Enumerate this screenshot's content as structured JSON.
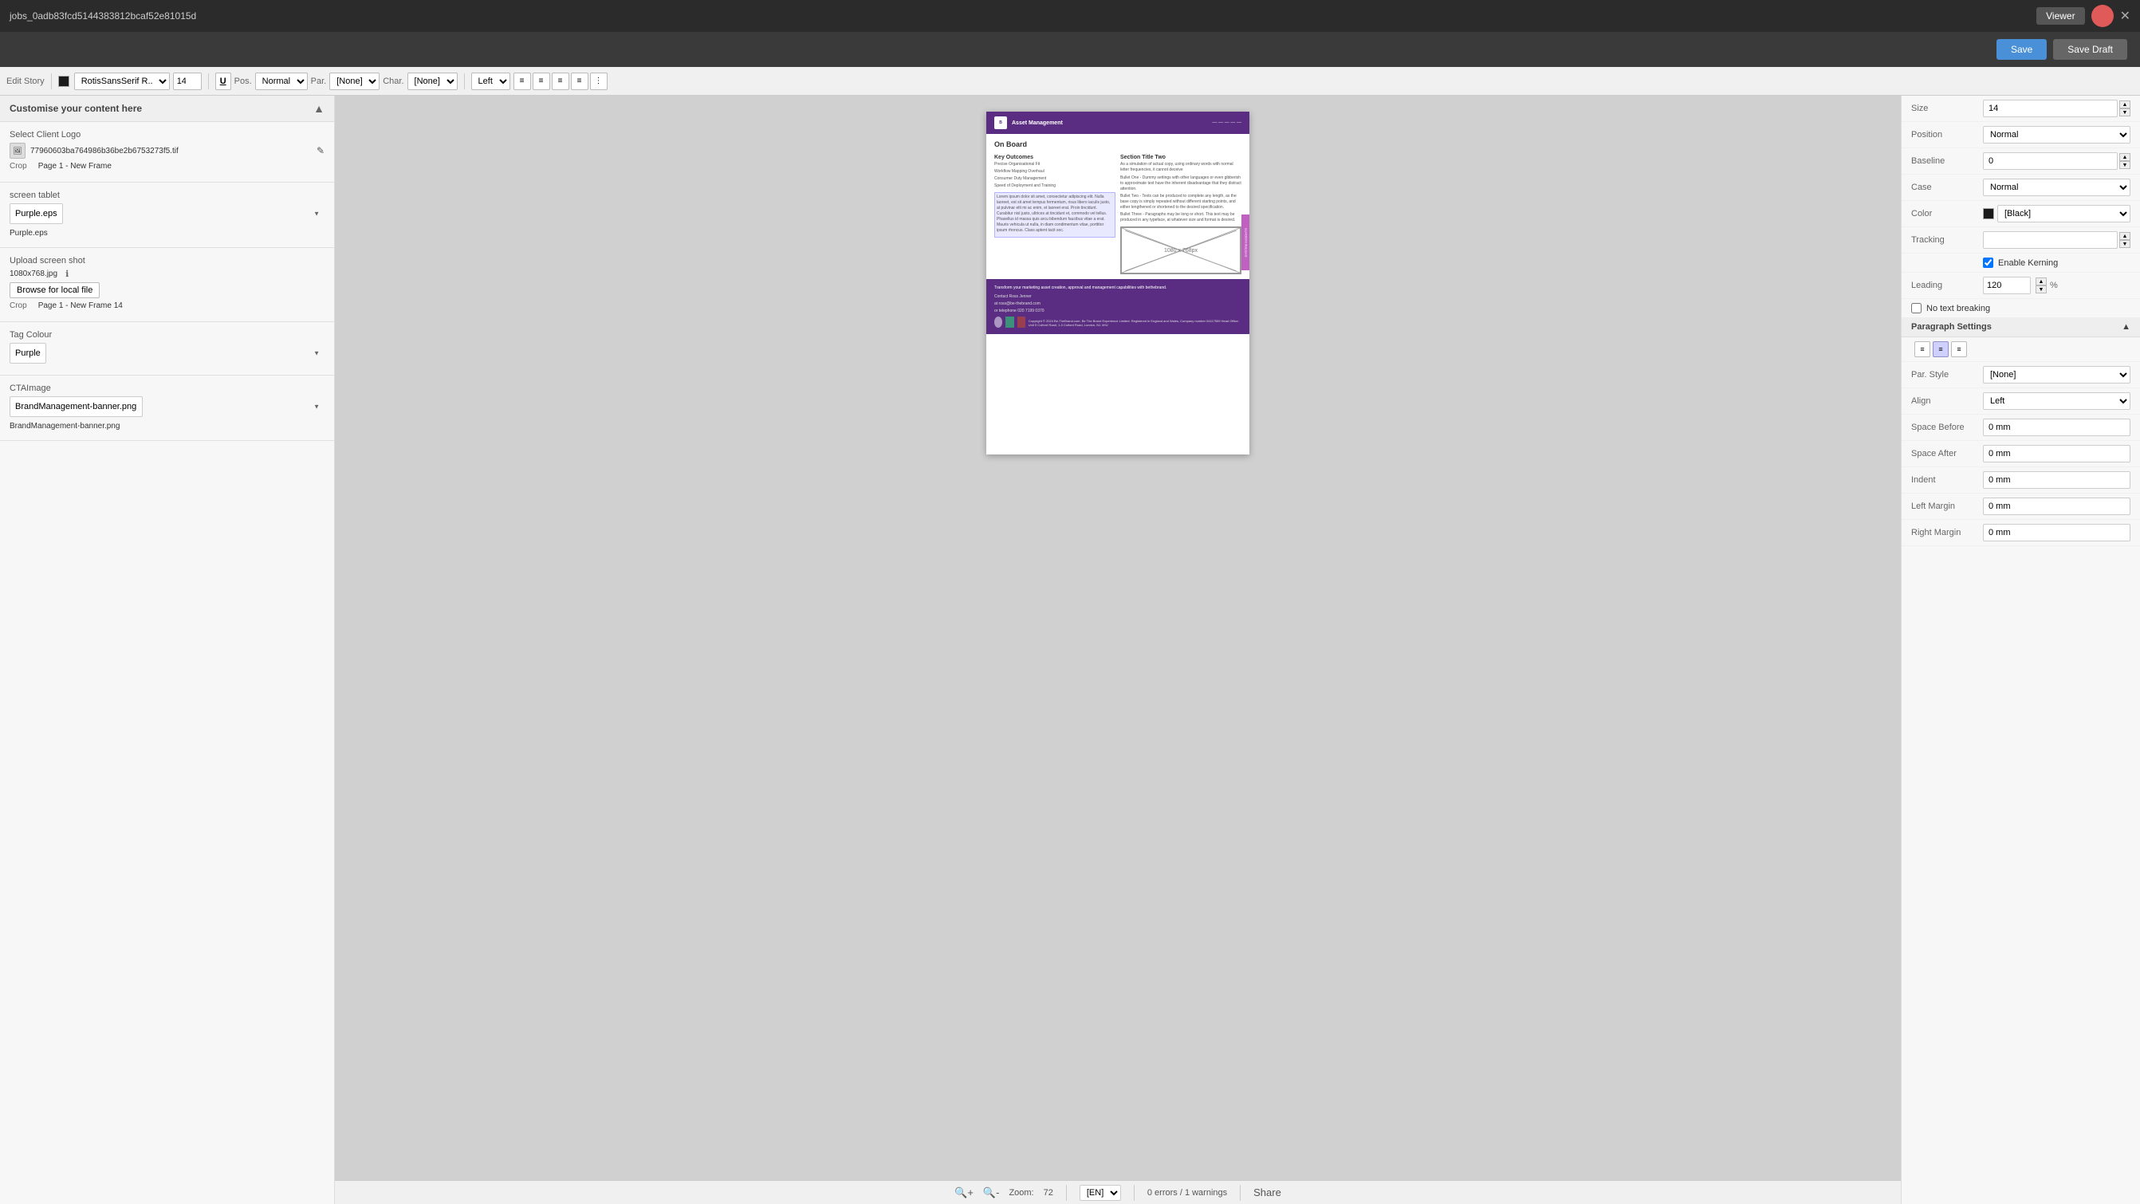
{
  "topbar": {
    "title": "jobs_0adb83fcd5144383812bcaf52e81015d",
    "viewer_label": "Viewer",
    "close_icon": "✕"
  },
  "savebar": {
    "save_label": "Save",
    "save_draft_label": "Save Draft"
  },
  "toolbar": {
    "edit_story_label": "Edit Story",
    "font_name": "RotisSansSerif R...",
    "font_size": "14",
    "pos_label": "Pos.",
    "pos_value": "Normal",
    "par_label": "Par.",
    "par_value": "[None]",
    "char_label": "Char.",
    "char_value": "[None]",
    "align_label": "Left",
    "underline_icon": "U",
    "color_label": "[Black]"
  },
  "left_panel": {
    "header": "Customise your content here",
    "toggle_icon": "▲",
    "client_logo_label": "Select Client Logo",
    "client_logo_file": "77960603ba764986b36be2b6753273f5.tif",
    "client_logo_edit_icon": "✎",
    "client_logo_crop_label": "Crop",
    "client_logo_crop_value": "Page 1 - New Frame",
    "screen_tablet_label": "screen tablet",
    "screen_tablet_file": "Purple.eps",
    "screen_tablet_option": "Purple.eps",
    "upload_shot_label": "Upload screen shot",
    "upload_shot_size": "1080x768.jpg",
    "upload_shot_info_icon": "ℹ",
    "browse_btn": "Browse for local file",
    "upload_crop_label": "Crop",
    "upload_crop_value": "Page 1 - New Frame 14",
    "tag_colour_label": "Tag Colour",
    "tag_colour_value": "Purple",
    "cta_image_label": "CTAImage",
    "cta_image_file": "BrandManagement-banner.png",
    "cta_image_display": "BrandManagement-banner.png"
  },
  "canvas": {
    "header_text": "Asset Management",
    "on_board_title": "On Board",
    "section_title_two": "Section Title Two",
    "section_title_two_body": "As a simulation of actual copy, using ordinary words with normal letter frequencies, it cannot deceive",
    "key_outcomes_label": "Key Outcomes",
    "outcome_1": "Precise Organisational Fit",
    "outcome_2": "Workflow Mapping Overhaul",
    "outcome_3": "Consumer Duty Management",
    "outcome_4": "Speed of Deployment and Training",
    "bullet_one": "Bullet One - Dummy settings with other languages or even gibberish to approximate text have the inherent disadvantage that they distract attention.",
    "bullet_two": "Bullet Two - Texts can be produced to complete any length, as the base copy is simply repeated without different starting points, and either lengthened or shortened to the desired specification.",
    "bullet_three": "Bullet Three - Paragraphs may be long or short. This text may be produced in any typeface, at whatever size and format is desired.",
    "lorem_ipsum_text": "Lorem ipsum dolor sit amet, consectetur adipiscing elit. Nulla laoreet, est sit amet tempus fermentum, risus libero iaculis justo, at pulvinar elit mi ac enim, et laoreet erat. Proin tincidunt. Curabitur nisl justo, ultrices at tincidunt et, commodo vel tellus. Phasellus id massa quis arcu bibendum faucibus vitae a erat. Mauris vehicula ut nulla, in diam condimentum vitae, porttitor ipsum rhoncus. Class aptent tacit soc.",
    "image_placeholder": "1080 x 768px",
    "system_insights": "SYSTEM INSIGHTS",
    "footer_text": "Transform your marketing asset creation, approval and management capabilities with bethebrand.",
    "footer_contact_name": "Contact Ross Jenner",
    "footer_contact_email": "at ross@be-thebrand.com",
    "footer_contact_phone": "or telephone 020 7199 0370",
    "footer_copyright": "Copyright © 2024 Be-TheBrand.com. Be The Brand Experience Limited. Registered in England and Wales, Company number 04117559 Head Office: Unit 5 Culford Road, 1-3 Culford Road, London, N1 4HU"
  },
  "statusbar": {
    "zoom_label": "Zoom:",
    "zoom_value": "72",
    "lang_value": "[EN]",
    "errors_label": "0 errors / 1 warnings",
    "share_label": "Share"
  },
  "right_panel": {
    "size_label": "Size",
    "size_value": "14",
    "position_label": "Position",
    "position_value": "Normal",
    "baseline_label": "Baseline",
    "baseline_value": "0",
    "case_label": "Case",
    "case_value": "Normal",
    "color_label": "Color",
    "color_value": "[Black]",
    "color_swatch": "#1a1a1a",
    "tracking_label": "Tracking",
    "tracking_value": "",
    "enable_kerning_label": "Enable Kerning",
    "enable_kerning_checked": true,
    "leading_label": "Leading",
    "leading_value": "120",
    "leading_unit": "%",
    "no_text_breaking_label": "No text breaking",
    "paragraph_settings_label": "Paragraph Settings",
    "par_style_label": "Par. Style",
    "par_style_value": "[None]",
    "align_label": "Align",
    "align_value": "Left",
    "space_before_label": "Space Before",
    "space_before_value": "0 mm",
    "space_after_label": "Space After",
    "space_after_value": "0 mm",
    "indent_label": "Indent",
    "indent_value": "0 mm",
    "left_margin_label": "Left Margin",
    "left_margin_value": "0 mm",
    "right_margin_label": "Right Margin",
    "right_margin_value": "0 mm"
  }
}
